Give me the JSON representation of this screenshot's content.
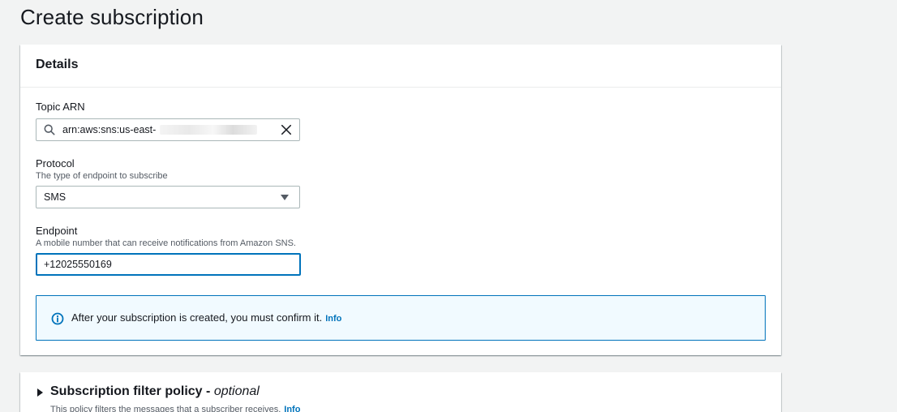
{
  "page": {
    "title": "Create subscription"
  },
  "details": {
    "heading": "Details",
    "topic_arn": {
      "label": "Topic ARN",
      "value": "arn:aws:sns:us-east-"
    },
    "protocol": {
      "label": "Protocol",
      "description": "The type of endpoint to subscribe",
      "value": "SMS"
    },
    "endpoint": {
      "label": "Endpoint",
      "description": "A mobile number that can receive notifications from Amazon SNS.",
      "value": "+12025550169"
    },
    "alert": {
      "message": "After your subscription is created, you must confirm it.",
      "link": "Info"
    }
  },
  "filter_policy": {
    "heading": "Subscription filter policy -",
    "optional": "optional",
    "description": "This policy filters the messages that a subscriber receives.",
    "link": "Info"
  },
  "colors": {
    "accent": "#0073bb",
    "text": "#16191f",
    "muted": "#545b64",
    "background": "#f2f3f3"
  }
}
